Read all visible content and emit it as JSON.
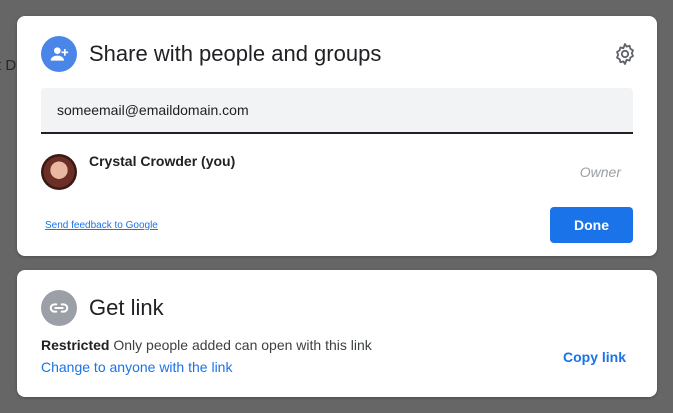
{
  "background": {
    "partial_text": "t D"
  },
  "share_dialog": {
    "title": "Share with people and groups",
    "email_input_value": "someemail@emaildomain.com",
    "person": {
      "name": "Crystal Crowder (you)",
      "role": "Owner"
    },
    "feedback_link": "Send feedback to Google",
    "done_label": "Done",
    "header_icon": "person-add-icon",
    "settings_icon": "gear-icon"
  },
  "get_link": {
    "title": "Get link",
    "access_level": "Restricted",
    "access_description": "Only people added can open with this link",
    "change_link": "Change to anyone with the link",
    "copy_link": "Copy link",
    "header_icon": "link-icon"
  },
  "colors": {
    "accent": "#1a73e8",
    "share_icon_bg": "#4a86e8",
    "link_icon_bg": "#9aa0a6",
    "overlay": "#666666"
  }
}
